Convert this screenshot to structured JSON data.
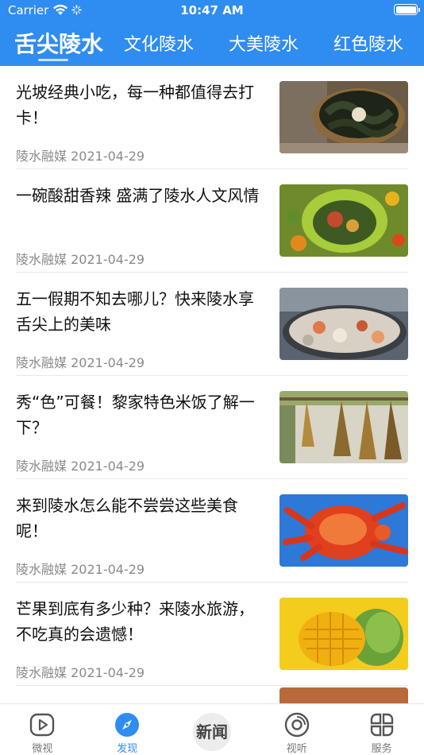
{
  "status_bar": {
    "carrier": "Carrier",
    "time": "10:47 AM"
  },
  "tabs": [
    {
      "label": "舌尖陵水",
      "active": true
    },
    {
      "label": "文化陵水",
      "active": false
    },
    {
      "label": "大美陵水",
      "active": false
    },
    {
      "label": "红色陵水",
      "active": false
    }
  ],
  "articles": [
    {
      "title": "光坡经典小吃，每一种都值得去打卡！",
      "source": "陵水融媒",
      "date": "2021-04-29"
    },
    {
      "title": "一碗酸甜香辣  盛满了陵水人文风情",
      "source": "陵水融媒",
      "date": "2021-04-29"
    },
    {
      "title": "五一假期不知去哪儿？快来陵水享舌尖上的美味",
      "source": "陵水融媒",
      "date": "2021-04-29"
    },
    {
      "title": "秀“色”可餐！黎家特色米饭了解一下？",
      "source": "陵水融媒",
      "date": "2021-04-29"
    },
    {
      "title": "来到陵水怎么能不尝尝这些美食呢！",
      "source": "陵水融媒",
      "date": "2021-04-29"
    },
    {
      "title": "芒果到底有多少种？来陵水旅游，不吃真的会遗憾！",
      "source": "陵水融媒",
      "date": "2021-04-29"
    }
  ],
  "bottom_tabs": [
    {
      "label": "微视",
      "icon": "play-icon",
      "active": false
    },
    {
      "label": "发现",
      "icon": "compass-icon",
      "active": true
    },
    {
      "label": "新闻",
      "icon": "news-logo-icon",
      "active": false
    },
    {
      "label": "视听",
      "icon": "disc-icon",
      "active": false
    },
    {
      "label": "服务",
      "icon": "grid-icon",
      "active": false
    }
  ],
  "colors": {
    "brand": "#2f8cf0",
    "text": "#111111",
    "meta": "#8a8a8a"
  }
}
